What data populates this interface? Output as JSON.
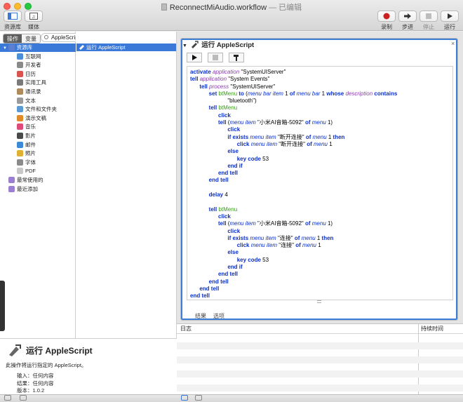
{
  "window": {
    "title": "ReconnectMiAudio.workflow",
    "subtitle": "— 已编辑"
  },
  "toolbar": {
    "left": [
      {
        "label": "资源库",
        "icon": "library-icon"
      },
      {
        "label": "媒体",
        "icon": "media-icon"
      }
    ],
    "right": [
      {
        "label": "录制",
        "icon": "record-icon"
      },
      {
        "label": "步进",
        "icon": "step-icon"
      },
      {
        "label": "停止",
        "icon": "stop-icon"
      },
      {
        "label": "运行",
        "icon": "run-icon"
      }
    ]
  },
  "sidebar": {
    "segment": [
      "操作",
      "变量"
    ],
    "items": [
      {
        "label": "资源库",
        "color": "#5b7fd1",
        "selected": true
      },
      {
        "label": "互联网",
        "color": "#4a90d9"
      },
      {
        "label": "开发者",
        "color": "#8a8a8a"
      },
      {
        "label": "日历",
        "color": "#d9534f"
      },
      {
        "label": "实用工具",
        "color": "#7a7a7a"
      },
      {
        "label": "通讯录",
        "color": "#b08a5a"
      },
      {
        "label": "文本",
        "color": "#9a9a9a"
      },
      {
        "label": "文件和文件夹",
        "color": "#5b9bd5"
      },
      {
        "label": "演示文稿",
        "color": "#e08a2a"
      },
      {
        "label": "音乐",
        "color": "#e04a7a"
      },
      {
        "label": "影片",
        "color": "#4a4a4a"
      },
      {
        "label": "邮件",
        "color": "#3a8ad9"
      },
      {
        "label": "照片",
        "color": "#e0b030"
      },
      {
        "label": "字体",
        "color": "#8a8a8a"
      },
      {
        "label": "PDF",
        "color": "#c8c8c8"
      },
      {
        "label": "最常使用的",
        "color": "#9b7fd1"
      },
      {
        "label": "最近添加",
        "color": "#9b7fd1"
      }
    ]
  },
  "search": {
    "value": "AppleScript"
  },
  "action_list": [
    {
      "label": "运行 AppleScript",
      "selected": true
    }
  ],
  "description": {
    "title": "运行 AppleScript",
    "text": "此操作将运行指定的 AppleScript。",
    "fields": [
      {
        "key": "输入：",
        "value": "任何内容"
      },
      {
        "key": "结果：",
        "value": "任何内容"
      },
      {
        "key": "版本：",
        "value": "1.0.2"
      }
    ]
  },
  "action": {
    "title": "运行 AppleScript",
    "tabs": [
      "结果",
      "选项"
    ],
    "code": [
      [
        {
          "t": "activate ",
          "c": "kw"
        },
        {
          "t": "application ",
          "c": "ap"
        },
        {
          "t": "\"SystemUIServer\""
        }
      ],
      [
        {
          "t": "tell ",
          "c": "kw"
        },
        {
          "t": "application ",
          "c": "ap"
        },
        {
          "t": "\"System Events\""
        }
      ],
      [
        {
          "t": "      "
        },
        {
          "t": "tell ",
          "c": "kw"
        },
        {
          "t": "process ",
          "c": "ap"
        },
        {
          "t": "\"SystemUIServer\""
        }
      ],
      [
        {
          "t": "            "
        },
        {
          "t": "set ",
          "c": "kw"
        },
        {
          "t": "btMenu ",
          "c": "vr"
        },
        {
          "t": "to ",
          "c": "kw"
        },
        {
          "t": "("
        },
        {
          "t": "menu bar item ",
          "c": "it"
        },
        {
          "t": "1 "
        },
        {
          "t": "of ",
          "c": "kw"
        },
        {
          "t": "menu bar ",
          "c": "it"
        },
        {
          "t": "1 "
        },
        {
          "t": "whose ",
          "c": "kw"
        },
        {
          "t": "description ",
          "c": "ap"
        },
        {
          "t": "contains",
          "c": "kw"
        }
      ],
      [
        {
          "t": "                        \"bluetooth\")"
        }
      ],
      [
        {
          "t": "            "
        },
        {
          "t": "tell ",
          "c": "kw"
        },
        {
          "t": "btMenu",
          "c": "vr"
        }
      ],
      [
        {
          "t": "                  "
        },
        {
          "t": "click",
          "c": "kw"
        }
      ],
      [
        {
          "t": "                  "
        },
        {
          "t": "tell ",
          "c": "kw"
        },
        {
          "t": "("
        },
        {
          "t": "menu item ",
          "c": "it"
        },
        {
          "t": "\"小米AI音箱-5092\" "
        },
        {
          "t": "of ",
          "c": "kw"
        },
        {
          "t": "menu ",
          "c": "it"
        },
        {
          "t": "1)"
        }
      ],
      [
        {
          "t": "                        "
        },
        {
          "t": "click",
          "c": "kw"
        }
      ],
      [
        {
          "t": "                        "
        },
        {
          "t": "if ",
          "c": "kw"
        },
        {
          "t": "exists ",
          "c": "kw"
        },
        {
          "t": "menu item ",
          "c": "it"
        },
        {
          "t": "\"断开连接\" "
        },
        {
          "t": "of ",
          "c": "kw"
        },
        {
          "t": "menu ",
          "c": "it"
        },
        {
          "t": "1 "
        },
        {
          "t": "then",
          "c": "kw"
        }
      ],
      [
        {
          "t": "                              "
        },
        {
          "t": "click ",
          "c": "kw"
        },
        {
          "t": "menu item ",
          "c": "it"
        },
        {
          "t": "\"断开连接\" "
        },
        {
          "t": "of ",
          "c": "kw"
        },
        {
          "t": "menu ",
          "c": "it"
        },
        {
          "t": "1"
        }
      ],
      [
        {
          "t": "                        "
        },
        {
          "t": "else",
          "c": "kw"
        }
      ],
      [
        {
          "t": "                              "
        },
        {
          "t": "key code ",
          "c": "kw"
        },
        {
          "t": "53"
        }
      ],
      [
        {
          "t": "                        "
        },
        {
          "t": "end if",
          "c": "kw"
        }
      ],
      [
        {
          "t": "                  "
        },
        {
          "t": "end tell",
          "c": "kw"
        }
      ],
      [
        {
          "t": "            "
        },
        {
          "t": "end tell",
          "c": "kw"
        }
      ],
      [
        {
          "t": ""
        }
      ],
      [
        {
          "t": "            "
        },
        {
          "t": "delay ",
          "c": "kw"
        },
        {
          "t": "4"
        }
      ],
      [
        {
          "t": ""
        }
      ],
      [
        {
          "t": "            "
        },
        {
          "t": "tell ",
          "c": "kw"
        },
        {
          "t": "btMenu",
          "c": "vr"
        }
      ],
      [
        {
          "t": "                  "
        },
        {
          "t": "click",
          "c": "kw"
        }
      ],
      [
        {
          "t": "                  "
        },
        {
          "t": "tell ",
          "c": "kw"
        },
        {
          "t": "("
        },
        {
          "t": "menu item ",
          "c": "it"
        },
        {
          "t": "\"小米AI音箱-5092\" "
        },
        {
          "t": "of ",
          "c": "kw"
        },
        {
          "t": "menu ",
          "c": "it"
        },
        {
          "t": "1)"
        }
      ],
      [
        {
          "t": "                        "
        },
        {
          "t": "click",
          "c": "kw"
        }
      ],
      [
        {
          "t": "                        "
        },
        {
          "t": "if ",
          "c": "kw"
        },
        {
          "t": "exists ",
          "c": "kw"
        },
        {
          "t": "menu item ",
          "c": "it"
        },
        {
          "t": "\"连接\" "
        },
        {
          "t": "of ",
          "c": "kw"
        },
        {
          "t": "menu ",
          "c": "it"
        },
        {
          "t": "1 "
        },
        {
          "t": "then",
          "c": "kw"
        }
      ],
      [
        {
          "t": "                              "
        },
        {
          "t": "click ",
          "c": "kw"
        },
        {
          "t": "menu item ",
          "c": "it"
        },
        {
          "t": "\"连接\" "
        },
        {
          "t": "of ",
          "c": "kw"
        },
        {
          "t": "menu ",
          "c": "it"
        },
        {
          "t": "1"
        }
      ],
      [
        {
          "t": "                        "
        },
        {
          "t": "else",
          "c": "kw"
        }
      ],
      [
        {
          "t": "                              "
        },
        {
          "t": "key code ",
          "c": "kw"
        },
        {
          "t": "53"
        }
      ],
      [
        {
          "t": "                        "
        },
        {
          "t": "end if",
          "c": "kw"
        }
      ],
      [
        {
          "t": "                  "
        },
        {
          "t": "end tell",
          "c": "kw"
        }
      ],
      [
        {
          "t": "            "
        },
        {
          "t": "end tell",
          "c": "kw"
        }
      ],
      [
        {
          "t": "      "
        },
        {
          "t": "end tell",
          "c": "kw"
        }
      ],
      [
        {
          "t": "end tell",
          "c": "kw"
        }
      ]
    ]
  },
  "log": {
    "columns": [
      "日志",
      "持续时间"
    ]
  },
  "colors": {
    "accent": "#3b79d8",
    "record": "#cc1f1f"
  }
}
